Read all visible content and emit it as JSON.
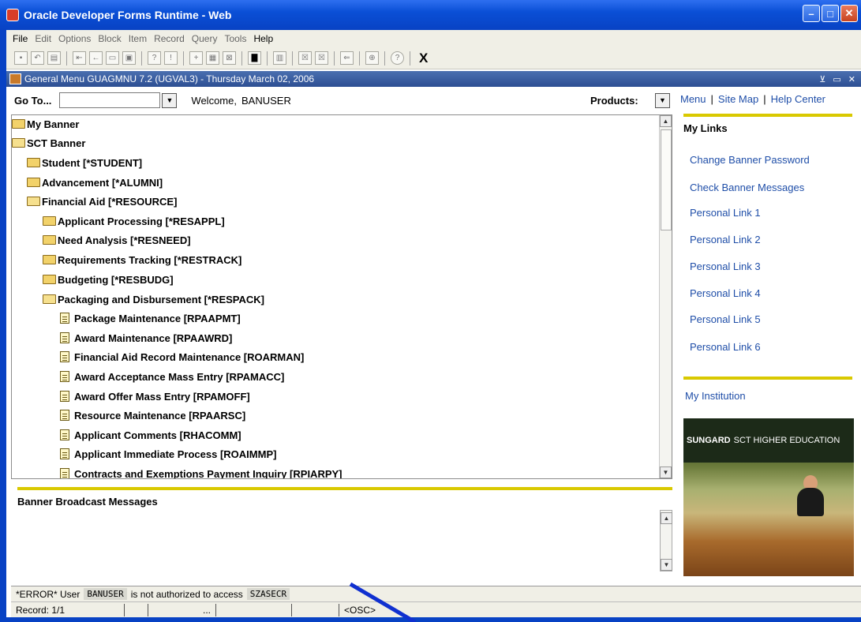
{
  "window": {
    "title": "Oracle Developer Forms Runtime - Web",
    "controls": {
      "minimize": "–",
      "maximize": "□",
      "close": "✕"
    }
  },
  "menubar": [
    "File",
    "Edit",
    "Options",
    "Block",
    "Item",
    "Record",
    "Query",
    "Tools",
    "Help"
  ],
  "toolbar": {
    "exit_label": "X"
  },
  "form_bar": {
    "title": "General Menu  GUAGMNU  7.2  (UGVAL3) - Thursday March 02, 2006",
    "controls": "⊻ ▭ ✕"
  },
  "goto": {
    "label": "Go To...",
    "value": "",
    "welcome_text": "Welcome,",
    "user": "BANUSER",
    "products_label": "Products:"
  },
  "tree": [
    {
      "label": "My Banner",
      "kind": "folder",
      "open": false,
      "level": 0
    },
    {
      "label": "SCT Banner",
      "kind": "folder",
      "open": true,
      "level": 0
    },
    {
      "label": "Student [*STUDENT]",
      "kind": "folder",
      "open": false,
      "level": 1
    },
    {
      "label": "Advancement [*ALUMNI]",
      "kind": "folder",
      "open": false,
      "level": 1
    },
    {
      "label": "Financial Aid [*RESOURCE]",
      "kind": "folder",
      "open": true,
      "level": 1
    },
    {
      "label": "Applicant Processing [*RESAPPL]",
      "kind": "folder",
      "open": false,
      "level": 2
    },
    {
      "label": "Need Analysis [*RESNEED]",
      "kind": "folder",
      "open": false,
      "level": 2
    },
    {
      "label": "Requirements Tracking [*RESTRACK]",
      "kind": "folder",
      "open": false,
      "level": 2
    },
    {
      "label": "Budgeting [*RESBUDG]",
      "kind": "folder",
      "open": false,
      "level": 2
    },
    {
      "label": "Packaging and Disbursement [*RESPACK]",
      "kind": "folder",
      "open": true,
      "level": 2
    },
    {
      "label": "Package Maintenance [RPAAPMT]",
      "kind": "form",
      "level": 3
    },
    {
      "label": "Award Maintenance [RPAAWRD]",
      "kind": "form",
      "level": 3
    },
    {
      "label": "Financial Aid Record Maintenance [ROARMAN]",
      "kind": "form",
      "level": 3
    },
    {
      "label": "Award Acceptance Mass Entry [RPAMACC]",
      "kind": "form",
      "level": 3
    },
    {
      "label": "Award Offer Mass Entry [RPAMOFF]",
      "kind": "form",
      "level": 3
    },
    {
      "label": "Resource Maintenance [RPAARSC]",
      "kind": "form",
      "level": 3
    },
    {
      "label": "Applicant Comments [RHACOMM]",
      "kind": "form",
      "level": 3
    },
    {
      "label": "Applicant Immediate Process [ROAIMMP]",
      "kind": "form",
      "level": 3
    },
    {
      "label": "Contracts and Exemptions Payment Inquiry [RPIARPY]",
      "kind": "form",
      "level": 3
    }
  ],
  "top_links": {
    "menu": "Menu",
    "sitemap": "Site Map",
    "help": "Help Center",
    "sep": "|"
  },
  "my_links": {
    "heading": "My Links",
    "items": [
      "Change Banner Password",
      "Check Banner Messages",
      "Personal Link 1",
      "Personal Link 2",
      "Personal Link 3",
      "Personal Link 4",
      "Personal Link 5",
      "Personal Link 6"
    ]
  },
  "institution": {
    "link": "My Institution",
    "brand_bold": "SUNGARD",
    "brand_rest": "SCT HIGHER EDUCATION"
  },
  "broadcast": {
    "heading": "Banner Broadcast Messages"
  },
  "status": {
    "error_prefix": "*ERROR* User",
    "user": "BANUSER",
    "error_middle": "is not authorized to access",
    "object": "SZASECR",
    "record": "Record: 1/1",
    "ellipsis": "...",
    "osc": "<OSC>"
  },
  "colors": {
    "title_blue": "#0a4fd6",
    "link_blue": "#1f4ea8",
    "accent_yellow": "#d9c900",
    "annotation_blue": "#1030d0"
  }
}
